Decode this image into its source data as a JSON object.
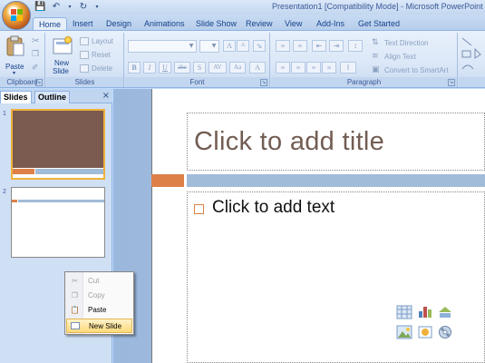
{
  "window": {
    "title": "Presentation1 [Compatibility Mode] - Microsoft PowerPoint"
  },
  "tabs": [
    "Home",
    "Insert",
    "Design",
    "Animations",
    "Slide Show",
    "Review",
    "View",
    "Add-Ins",
    "Get Started"
  ],
  "active_tab": "Home",
  "ribbon": {
    "clipboard": {
      "label": "Clipboard",
      "paste": "Paste"
    },
    "slides": {
      "label": "Slides",
      "new_slide_line1": "New",
      "new_slide_line2": "Slide",
      "layout": "Layout",
      "reset": "Reset",
      "delete": "Delete"
    },
    "font": {
      "label": "Font",
      "bold": "B",
      "italic": "I",
      "underline": "U",
      "strike": "abc",
      "shadow": "S",
      "spacing": "AV",
      "case": "Aa",
      "grow": "A",
      "shrink": "A",
      "color": "A"
    },
    "paragraph": {
      "label": "Paragraph",
      "text_direction": "Text Direction",
      "align_text": "Align Text",
      "convert_smartart": "Convert to SmartArt"
    }
  },
  "pane": {
    "tab_slides": "Slides",
    "tab_outline": "Outline",
    "close": "×",
    "slide_numbers": [
      "1",
      "2"
    ]
  },
  "context_menu": {
    "items": [
      {
        "label": "Cut",
        "enabled": false
      },
      {
        "label": "Copy",
        "enabled": false
      },
      {
        "label": "Paste",
        "enabled": true
      },
      {
        "label": "New Slide",
        "enabled": true,
        "highlighted": true
      }
    ]
  },
  "slide": {
    "title_placeholder": "Click to add title",
    "body_placeholder": "Click to add text"
  },
  "colors": {
    "accent_orange": "#dd8048",
    "accent_blue": "#a0bcd9",
    "thumb_brown": "#7b5b4f",
    "title_color": "#725d53"
  }
}
